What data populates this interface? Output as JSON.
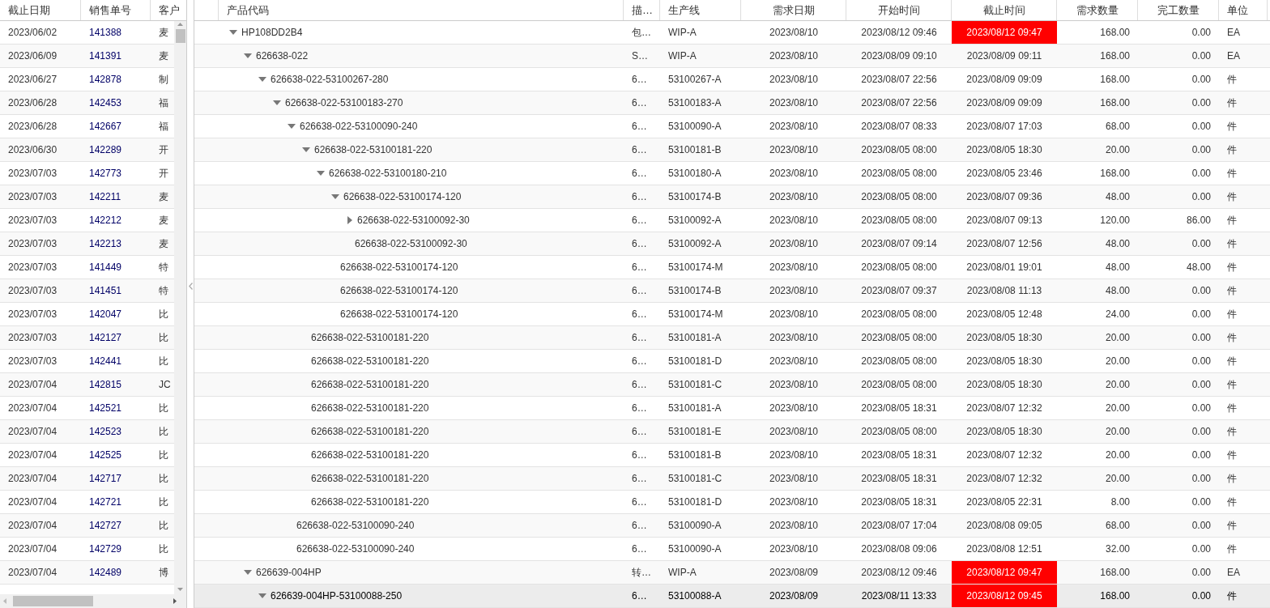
{
  "orders": {
    "columns": [
      "截止日期",
      "销售单号",
      "客户"
    ],
    "rows": [
      {
        "date": "2023/06/02",
        "order": "141388",
        "customer": "麦"
      },
      {
        "date": "2023/06/09",
        "order": "141391",
        "customer": "麦"
      },
      {
        "date": "2023/06/27",
        "order": "142878",
        "customer": "制"
      },
      {
        "date": "2023/06/28",
        "order": "142453",
        "customer": "福"
      },
      {
        "date": "2023/06/28",
        "order": "142667",
        "customer": "福"
      },
      {
        "date": "2023/06/30",
        "order": "142289",
        "customer": "开"
      },
      {
        "date": "2023/07/03",
        "order": "142773",
        "customer": "开"
      },
      {
        "date": "2023/07/03",
        "order": "142211",
        "customer": "麦"
      },
      {
        "date": "2023/07/03",
        "order": "142212",
        "customer": "麦"
      },
      {
        "date": "2023/07/03",
        "order": "142213",
        "customer": "麦"
      },
      {
        "date": "2023/07/03",
        "order": "141449",
        "customer": "特"
      },
      {
        "date": "2023/07/03",
        "order": "141451",
        "customer": "特"
      },
      {
        "date": "2023/07/03",
        "order": "142047",
        "customer": "比"
      },
      {
        "date": "2023/07/03",
        "order": "142127",
        "customer": "比"
      },
      {
        "date": "2023/07/03",
        "order": "142441",
        "customer": "比"
      },
      {
        "date": "2023/07/04",
        "order": "142815",
        "customer": "JC"
      },
      {
        "date": "2023/07/04",
        "order": "142521",
        "customer": "比"
      },
      {
        "date": "2023/07/04",
        "order": "142523",
        "customer": "比"
      },
      {
        "date": "2023/07/04",
        "order": "142525",
        "customer": "比"
      },
      {
        "date": "2023/07/04",
        "order": "142717",
        "customer": "比"
      },
      {
        "date": "2023/07/04",
        "order": "142721",
        "customer": "比"
      },
      {
        "date": "2023/07/04",
        "order": "142727",
        "customer": "比"
      },
      {
        "date": "2023/07/04",
        "order": "142729",
        "customer": "比"
      },
      {
        "date": "2023/07/04",
        "order": "142489",
        "customer": "博"
      }
    ]
  },
  "tree": {
    "columns": [
      "产品代码",
      "描…",
      "生产线",
      "需求日期",
      "开始时间",
      "截止时间",
      "需求数量",
      "完工数量",
      "单位"
    ],
    "rows": [
      {
        "code": "HP108DD2B4",
        "desc": "包…",
        "line": "WIP-A",
        "due": "2023/08/10",
        "start": "2023/08/12 09:46",
        "end": "2023/08/12 09:47",
        "overdue": true,
        "qty": "168.00",
        "done": "0.00",
        "unit": "EA",
        "selected": false,
        "expanded": true,
        "children": [
          {
            "code": "626638-022",
            "desc": "S…",
            "line": "WIP-A",
            "due": "2023/08/10",
            "start": "2023/08/09 09:10",
            "end": "2023/08/09 09:11",
            "overdue": false,
            "qty": "168.00",
            "done": "0.00",
            "unit": "EA",
            "selected": false,
            "expanded": true,
            "children": [
              {
                "code": "626638-022-53100267-280",
                "desc": "6…",
                "line": "53100267-A",
                "due": "2023/08/10",
                "start": "2023/08/07 22:56",
                "end": "2023/08/09 09:09",
                "overdue": false,
                "qty": "168.00",
                "done": "0.00",
                "unit": "件",
                "selected": false,
                "expanded": true,
                "children": [
                  {
                    "code": "626638-022-53100183-270",
                    "desc": "6…",
                    "line": "53100183-A",
                    "due": "2023/08/10",
                    "start": "2023/08/07 22:56",
                    "end": "2023/08/09 09:09",
                    "overdue": false,
                    "qty": "168.00",
                    "done": "0.00",
                    "unit": "件",
                    "selected": false,
                    "expanded": true,
                    "children": [
                      {
                        "code": "626638-022-53100090-240",
                        "desc": "6…",
                        "line": "53100090-A",
                        "due": "2023/08/10",
                        "start": "2023/08/07 08:33",
                        "end": "2023/08/07 17:03",
                        "overdue": false,
                        "qty": "68.00",
                        "done": "0.00",
                        "unit": "件",
                        "selected": false,
                        "expanded": true,
                        "children": [
                          {
                            "code": "626638-022-53100181-220",
                            "desc": "6…",
                            "line": "53100181-B",
                            "due": "2023/08/10",
                            "start": "2023/08/05 08:00",
                            "end": "2023/08/05 18:30",
                            "overdue": false,
                            "qty": "20.00",
                            "done": "0.00",
                            "unit": "件",
                            "selected": false,
                            "expanded": true,
                            "children": [
                              {
                                "code": "626638-022-53100180-210",
                                "desc": "6…",
                                "line": "53100180-A",
                                "due": "2023/08/10",
                                "start": "2023/08/05 08:00",
                                "end": "2023/08/05 23:46",
                                "overdue": false,
                                "qty": "168.00",
                                "done": "0.00",
                                "unit": "件",
                                "selected": false,
                                "expanded": true,
                                "children": [
                                  {
                                    "code": "626638-022-53100174-120",
                                    "desc": "6…",
                                    "line": "53100174-B",
                                    "due": "2023/08/10",
                                    "start": "2023/08/05 08:00",
                                    "end": "2023/08/07 09:36",
                                    "overdue": false,
                                    "qty": "48.00",
                                    "done": "0.00",
                                    "unit": "件",
                                    "selected": false,
                                    "expanded": true,
                                    "children": [
                                      {
                                        "code": "626638-022-53100092-30",
                                        "desc": "6…",
                                        "line": "53100092-A",
                                        "due": "2023/08/10",
                                        "start": "2023/08/05 08:00",
                                        "end": "2023/08/07 09:13",
                                        "overdue": false,
                                        "qty": "120.00",
                                        "done": "86.00",
                                        "unit": "件",
                                        "selected": false,
                                        "expanded": false
                                      },
                                      {
                                        "code": "626638-022-53100092-30",
                                        "desc": "6…",
                                        "line": "53100092-A",
                                        "due": "2023/08/10",
                                        "start": "2023/08/07 09:14",
                                        "end": "2023/08/07 12:56",
                                        "overdue": false,
                                        "qty": "48.00",
                                        "done": "0.00",
                                        "unit": "件",
                                        "selected": false
                                      }
                                    ]
                                  },
                                  {
                                    "code": "626638-022-53100174-120",
                                    "desc": "6…",
                                    "line": "53100174-M",
                                    "due": "2023/08/10",
                                    "start": "2023/08/05 08:00",
                                    "end": "2023/08/01 19:01",
                                    "overdue": false,
                                    "qty": "48.00",
                                    "done": "48.00",
                                    "unit": "件",
                                    "selected": false
                                  },
                                  {
                                    "code": "626638-022-53100174-120",
                                    "desc": "6…",
                                    "line": "53100174-B",
                                    "due": "2023/08/10",
                                    "start": "2023/08/07 09:37",
                                    "end": "2023/08/08 11:13",
                                    "overdue": false,
                                    "qty": "48.00",
                                    "done": "0.00",
                                    "unit": "件",
                                    "selected": false
                                  },
                                  {
                                    "code": "626638-022-53100174-120",
                                    "desc": "6…",
                                    "line": "53100174-M",
                                    "due": "2023/08/10",
                                    "start": "2023/08/05 08:00",
                                    "end": "2023/08/05 12:48",
                                    "overdue": false,
                                    "qty": "24.00",
                                    "done": "0.00",
                                    "unit": "件",
                                    "selected": false
                                  }
                                ]
                              }
                            ]
                          },
                          {
                            "code": "626638-022-53100181-220",
                            "desc": "6…",
                            "line": "53100181-A",
                            "due": "2023/08/10",
                            "start": "2023/08/05 08:00",
                            "end": "2023/08/05 18:30",
                            "overdue": false,
                            "qty": "20.00",
                            "done": "0.00",
                            "unit": "件",
                            "selected": false
                          },
                          {
                            "code": "626638-022-53100181-220",
                            "desc": "6…",
                            "line": "53100181-D",
                            "due": "2023/08/10",
                            "start": "2023/08/05 08:00",
                            "end": "2023/08/05 18:30",
                            "overdue": false,
                            "qty": "20.00",
                            "done": "0.00",
                            "unit": "件",
                            "selected": false
                          },
                          {
                            "code": "626638-022-53100181-220",
                            "desc": "6…",
                            "line": "53100181-C",
                            "due": "2023/08/10",
                            "start": "2023/08/05 08:00",
                            "end": "2023/08/05 18:30",
                            "overdue": false,
                            "qty": "20.00",
                            "done": "0.00",
                            "unit": "件",
                            "selected": false
                          },
                          {
                            "code": "626638-022-53100181-220",
                            "desc": "6…",
                            "line": "53100181-A",
                            "due": "2023/08/10",
                            "start": "2023/08/05 18:31",
                            "end": "2023/08/07 12:32",
                            "overdue": false,
                            "qty": "20.00",
                            "done": "0.00",
                            "unit": "件",
                            "selected": false
                          },
                          {
                            "code": "626638-022-53100181-220",
                            "desc": "6…",
                            "line": "53100181-E",
                            "due": "2023/08/10",
                            "start": "2023/08/05 08:00",
                            "end": "2023/08/05 18:30",
                            "overdue": false,
                            "qty": "20.00",
                            "done": "0.00",
                            "unit": "件",
                            "selected": false
                          },
                          {
                            "code": "626638-022-53100181-220",
                            "desc": "6…",
                            "line": "53100181-B",
                            "due": "2023/08/10",
                            "start": "2023/08/05 18:31",
                            "end": "2023/08/07 12:32",
                            "overdue": false,
                            "qty": "20.00",
                            "done": "0.00",
                            "unit": "件",
                            "selected": false
                          },
                          {
                            "code": "626638-022-53100181-220",
                            "desc": "6…",
                            "line": "53100181-C",
                            "due": "2023/08/10",
                            "start": "2023/08/05 18:31",
                            "end": "2023/08/07 12:32",
                            "overdue": false,
                            "qty": "20.00",
                            "done": "0.00",
                            "unit": "件",
                            "selected": false
                          },
                          {
                            "code": "626638-022-53100181-220",
                            "desc": "6…",
                            "line": "53100181-D",
                            "due": "2023/08/10",
                            "start": "2023/08/05 18:31",
                            "end": "2023/08/05 22:31",
                            "overdue": false,
                            "qty": "8.00",
                            "done": "0.00",
                            "unit": "件",
                            "selected": false
                          }
                        ]
                      },
                      {
                        "code": "626638-022-53100090-240",
                        "desc": "6…",
                        "line": "53100090-A",
                        "due": "2023/08/10",
                        "start": "2023/08/07 17:04",
                        "end": "2023/08/08 09:05",
                        "overdue": false,
                        "qty": "68.00",
                        "done": "0.00",
                        "unit": "件",
                        "selected": false
                      },
                      {
                        "code": "626638-022-53100090-240",
                        "desc": "6…",
                        "line": "53100090-A",
                        "due": "2023/08/10",
                        "start": "2023/08/08 09:06",
                        "end": "2023/08/08 12:51",
                        "overdue": false,
                        "qty": "32.00",
                        "done": "0.00",
                        "unit": "件",
                        "selected": false
                      }
                    ]
                  }
                ]
              }
            ]
          },
          {
            "code": "626639-004HP",
            "desc": "转…",
            "line": "WIP-A",
            "due": "2023/08/09",
            "start": "2023/08/12 09:46",
            "end": "2023/08/12 09:47",
            "overdue": true,
            "qty": "168.00",
            "done": "0.00",
            "unit": "EA",
            "selected": false,
            "expanded": true,
            "children": [
              {
                "code": "626639-004HP-53100088-250",
                "desc": "6…",
                "line": "53100088-A",
                "due": "2023/08/09",
                "start": "2023/08/11 13:33",
                "end": "2023/08/12 09:45",
                "overdue": true,
                "qty": "168.00",
                "done": "0.00",
                "unit": "件",
                "selected": true,
                "expanded": true
              }
            ]
          }
        ]
      }
    ]
  }
}
